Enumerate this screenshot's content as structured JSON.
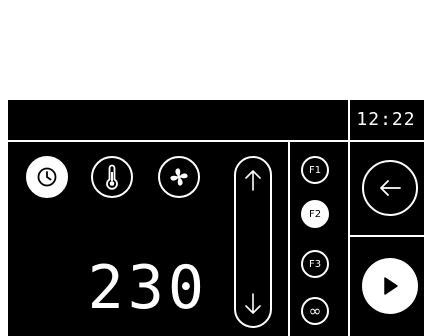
{
  "status_bar": {
    "clock": "12:22"
  },
  "modes": [
    {
      "name": "timer",
      "icon": "clock-icon",
      "active": true
    },
    {
      "name": "temperature",
      "icon": "thermometer-icon",
      "active": false
    },
    {
      "name": "fan",
      "icon": "fan-icon",
      "active": false
    }
  ],
  "display": {
    "value": "230"
  },
  "adjust": {
    "up_icon": "arrow-up-icon",
    "down_icon": "arrow-down-icon"
  },
  "functions": [
    {
      "label": "F1",
      "active": false
    },
    {
      "label": "F2",
      "active": true
    },
    {
      "label": "F3",
      "active": false
    },
    {
      "label": "∞",
      "active": false
    }
  ],
  "actions": {
    "back_icon": "arrow-left-icon",
    "start_icon": "play-icon"
  },
  "colors": {
    "panel_background": "#000000",
    "foreground": "#ffffff",
    "page_background": "#ffffff"
  }
}
